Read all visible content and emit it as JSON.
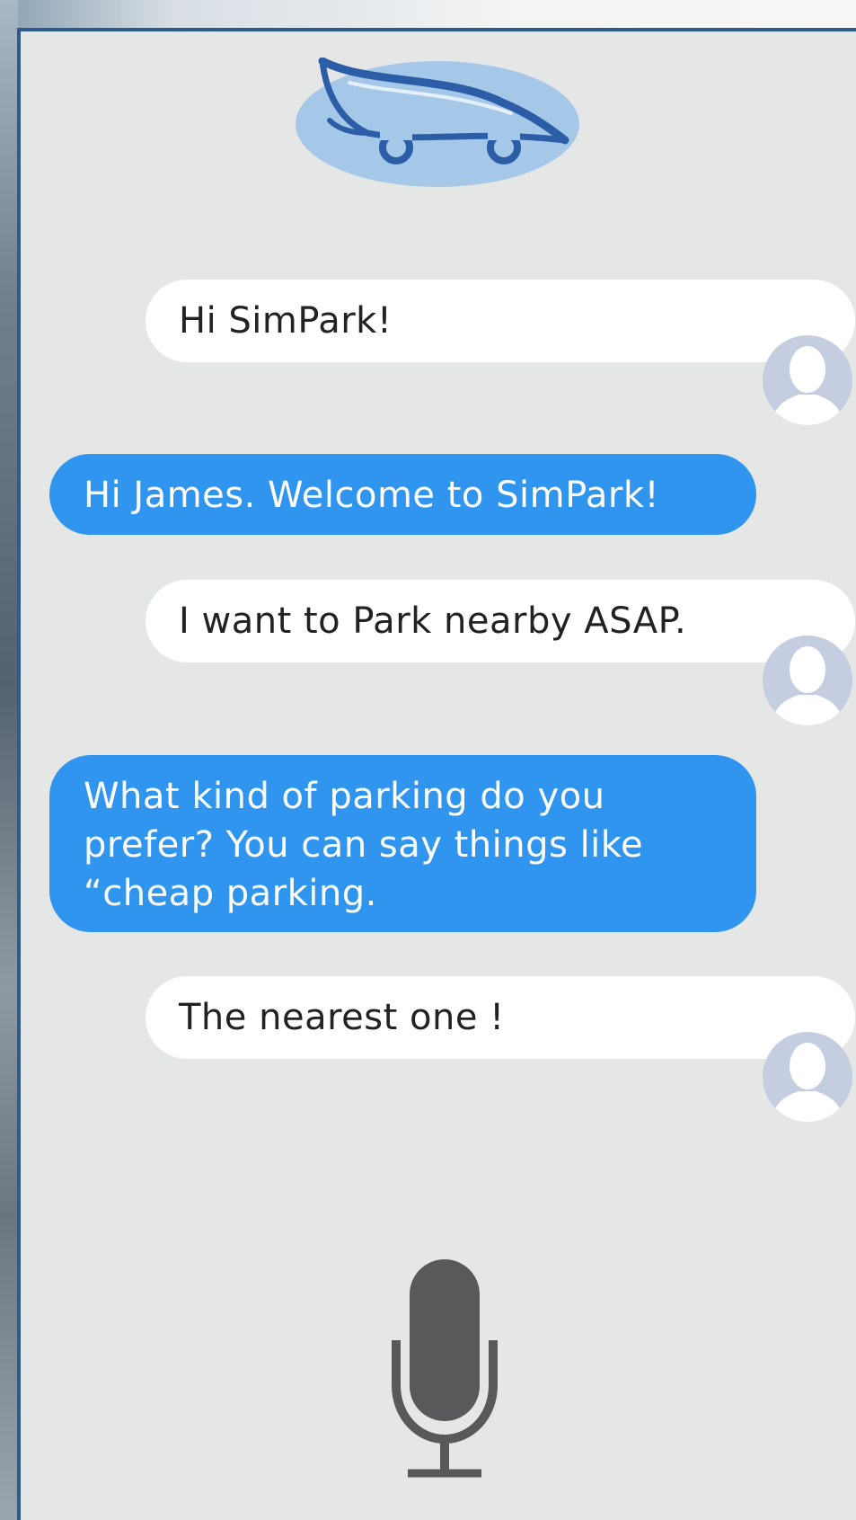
{
  "app": {
    "logo_icon": "car-leaf-logo",
    "mic_icon": "microphone-icon",
    "avatar_icon": "user-avatar-icon"
  },
  "colors": {
    "panel_border": "#2f5a8e",
    "panel_bg": "#e5e6e6",
    "bot_bubble": "#2f95ef",
    "user_bubble": "#ffffff",
    "mic": "#58595b",
    "logo_fill": "#a6c8e8",
    "logo_stroke": "#2c5ea8"
  },
  "conversation": {
    "messages": [
      {
        "sender": "user",
        "text": "Hi SimPark!"
      },
      {
        "sender": "bot",
        "text": "Hi James. Welcome to SimPark!"
      },
      {
        "sender": "user",
        "text": "I want to Park nearby ASAP."
      },
      {
        "sender": "bot",
        "text": "What kind of parking do you prefer? You can say things like “cheap parking."
      },
      {
        "sender": "user",
        "text": "The nearest one !"
      }
    ]
  }
}
